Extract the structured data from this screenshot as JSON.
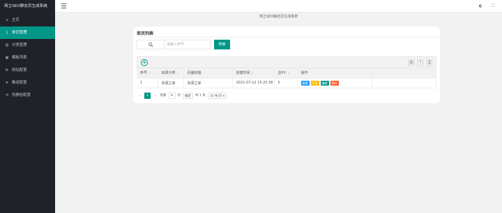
{
  "app": {
    "title": "简立SEO静态页生成系统"
  },
  "sidebar": {
    "items": [
      {
        "label": "主页",
        "icon": "home-icon",
        "active": false
      },
      {
        "label": "单页管理",
        "icon": "file-icon",
        "active": true
      },
      {
        "label": "分类管理",
        "icon": "category-icon",
        "active": false
      },
      {
        "label": "模板列表",
        "icon": "template-icon",
        "active": false
      },
      {
        "label": "网站配置",
        "icon": "settings-icon",
        "active": false
      },
      {
        "label": "推送配置",
        "icon": "push-icon",
        "active": false
      },
      {
        "label": "伪静态配置",
        "icon": "rewrite-icon",
        "active": false
      }
    ]
  },
  "header": {
    "breadcrumb": "简立SEO静态页生成系统"
  },
  "card": {
    "title": "单页列表"
  },
  "search": {
    "placeholder": "请输入序号",
    "button": "搜索"
  },
  "table": {
    "columns": [
      "序号",
      "目录分类",
      "页面标题",
      "创建时间",
      "总PV",
      "操作"
    ],
    "sortable": [
      true,
      true,
      false,
      true,
      true,
      false
    ],
    "rows": [
      {
        "id": "1",
        "category": "资源之家",
        "title": "资源之家",
        "created": "2021-07-12 15:25:36",
        "pv": "5"
      }
    ],
    "actions": [
      {
        "label": "查看",
        "color": "#1e9fff"
      },
      {
        "label": "生成",
        "color": "#ffb800"
      },
      {
        "label": "编辑",
        "color": "#009688"
      },
      {
        "label": "删除",
        "color": "#ff5722"
      }
    ]
  },
  "pagination": {
    "prev": "‹",
    "current": "1",
    "next": "›",
    "goto_label": "到第",
    "goto_value": "1",
    "page_unit": "页",
    "confirm": "确定",
    "total": "共 1 条",
    "per_page": "10 条/页"
  },
  "colors": {
    "primary": "#009688",
    "sidebar_bg": "#20222a"
  }
}
